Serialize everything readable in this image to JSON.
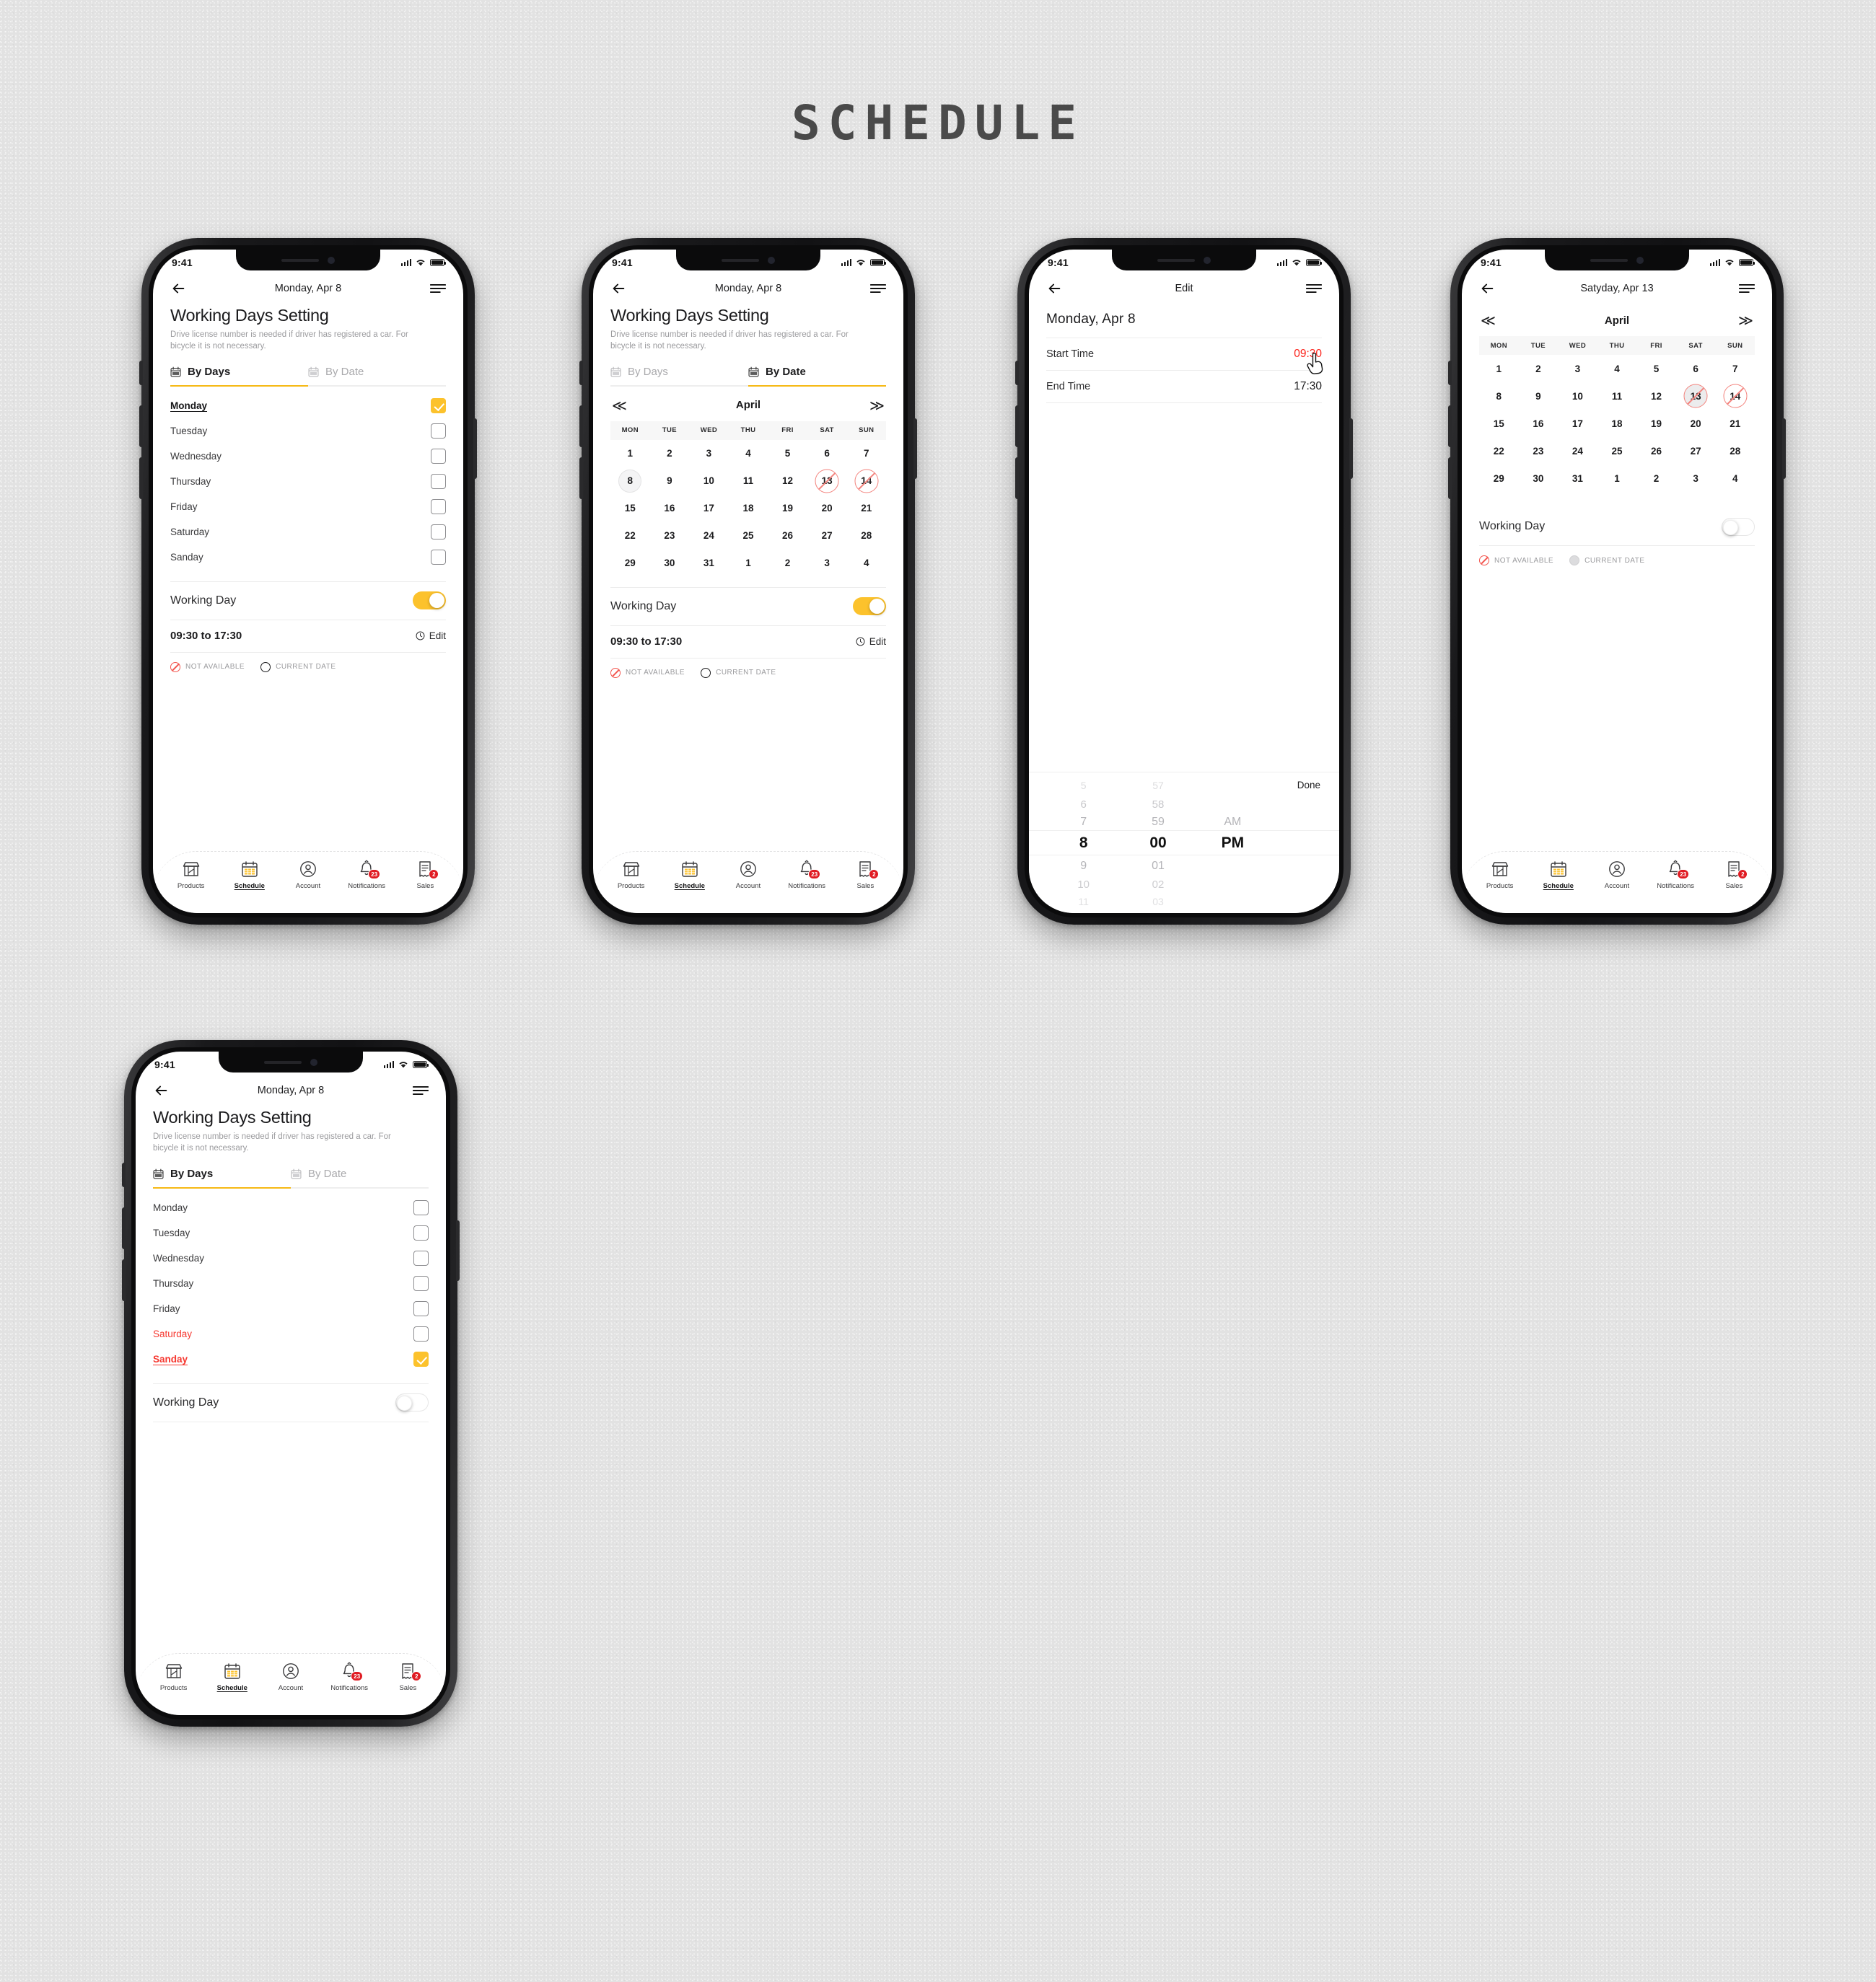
{
  "page": {
    "title": "SCHEDULE"
  },
  "colors": {
    "accent_yellow": "#fcc22c",
    "rail_yellow": "#f6b915",
    "danger_red": "#f3554e",
    "badge_red": "#e01b22",
    "time_red": "#fb231b",
    "page_bg": "#e2e2e2"
  },
  "status_bar": {
    "time": "9:41",
    "wifi_icon": "wifi-icon",
    "signal_icon": "cellular-signal-icon",
    "battery_icon": "battery-icon"
  },
  "nav": {
    "back_icon": "back-arrow-icon",
    "menu_icon": "hamburger-menu-icon"
  },
  "common": {
    "heading": "Working Days Setting",
    "subtitle": "Drive license number is needed if driver has registered a car. For bicycle it is not necessary.",
    "tab_by_days": "By Days",
    "tab_by_date": "By Date",
    "working_day_label": "Working Day",
    "time_range": "09:30 to 17:30",
    "edit_label": "Edit",
    "clock_icon": "clock-icon",
    "calendar_icon": "calendar-icon",
    "legend": {
      "not_available": "NOT AVAILABLE",
      "current_date": "CURRENT DATE",
      "not_available_icon": "not-available-icon",
      "current_date_icon": "current-date-icon"
    }
  },
  "days": [
    "Monday",
    "Tuesday",
    "Wednesday",
    "Thursday",
    "Friday",
    "Saturday",
    "Sanday"
  ],
  "calendar": {
    "month": "April",
    "prev_icon": "chevron-double-left-icon",
    "next_icon": "chevron-double-right-icon",
    "dow": [
      "MON",
      "TUE",
      "WED",
      "THU",
      "FRI",
      "SAT",
      "SUN"
    ],
    "weeks": [
      [
        "1",
        "2",
        "3",
        "4",
        "5",
        "6",
        "7"
      ],
      [
        "8",
        "9",
        "10",
        "11",
        "12",
        "13",
        "14"
      ],
      [
        "15",
        "16",
        "17",
        "18",
        "19",
        "20",
        "21"
      ],
      [
        "22",
        "23",
        "24",
        "25",
        "26",
        "27",
        "28"
      ],
      [
        "29",
        "30",
        "31",
        "1",
        "2",
        "3",
        "4"
      ]
    ],
    "not_available_dates": [
      "13",
      "14"
    ],
    "current_date": "8"
  },
  "tabbar": {
    "items": [
      {
        "label": "Products",
        "icon": "storefront-icon",
        "badge": ""
      },
      {
        "label": "Schedule",
        "icon": "calendar-icon",
        "badge": ""
      },
      {
        "label": "Account",
        "icon": "user-circle-icon",
        "badge": ""
      },
      {
        "label": "Notifications",
        "icon": "bell-icon",
        "badge": "23"
      },
      {
        "label": "Sales",
        "icon": "receipt-icon",
        "badge": "2"
      }
    ],
    "active": "Schedule"
  },
  "screens": {
    "s1": {
      "nav_title": "Monday, Apr 8",
      "active_tab": "By Days",
      "checked_day": "Monday",
      "working_day_on": true
    },
    "s2": {
      "nav_title": "Monday, Apr 8",
      "active_tab": "By Date",
      "working_day_on": true
    },
    "s3": {
      "nav_title": "Edit",
      "day_title": "Monday,  Apr 8",
      "start_time_label": "Start Time",
      "start_time_value": "09:30",
      "end_time_label": "End Time",
      "end_time_value": "17:30",
      "done_label": "Done",
      "cursor_icon": "pointing-hand-cursor-icon",
      "picker": {
        "hours": [
          "5",
          "6",
          "7",
          "8",
          "9",
          "10",
          "11"
        ],
        "minutes": [
          "57",
          "58",
          "59",
          "00",
          "01",
          "02",
          "03"
        ],
        "meridiem": [
          "AM",
          "PM"
        ],
        "selected_hour": "8",
        "selected_minute": "00",
        "selected_meridiem": "PM"
      }
    },
    "s4": {
      "nav_title": "Satyday, Apr 13",
      "working_day_on": false,
      "selected_date": "13"
    },
    "s5": {
      "nav_title": "Monday, Apr 8",
      "active_tab": "By Days",
      "checked_day": "Sanday",
      "red_days": [
        "Saturday",
        "Sanday"
      ],
      "working_day_on": false
    }
  }
}
